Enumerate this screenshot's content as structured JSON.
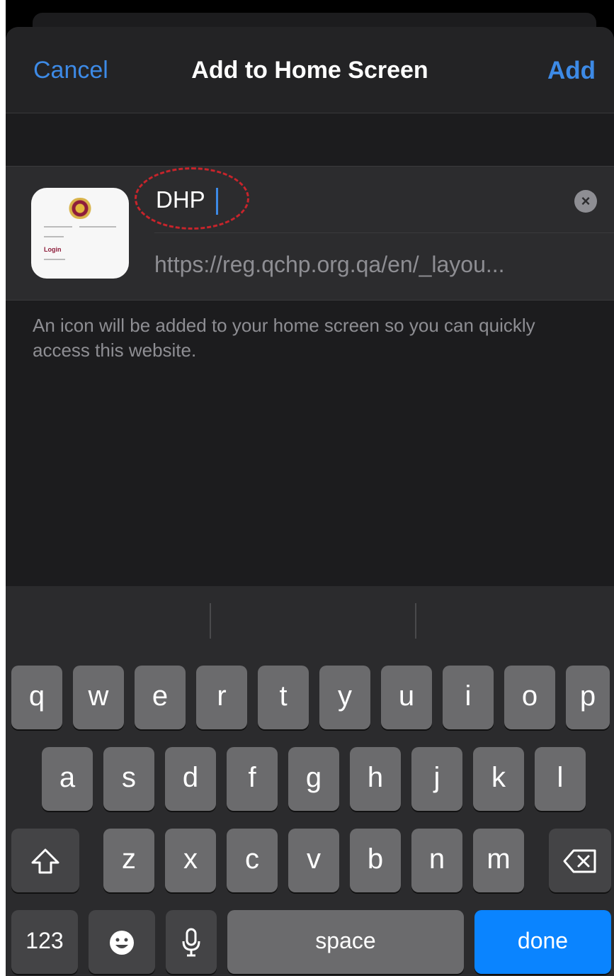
{
  "nav": {
    "cancel": "Cancel",
    "title": "Add to Home Screen",
    "add": "Add"
  },
  "form": {
    "name_value": "DHP",
    "url": "https://reg.qchp.org.qa/en/_layou...",
    "clear_icon": "clear-text-icon",
    "thumb_login": "Login"
  },
  "hint": "An icon will be added to your home screen so you can quickly access this website.",
  "keyboard": {
    "row1": [
      "q",
      "w",
      "e",
      "r",
      "t",
      "y",
      "u",
      "i",
      "o",
      "p"
    ],
    "row2": [
      "a",
      "s",
      "d",
      "f",
      "g",
      "h",
      "j",
      "k",
      "l"
    ],
    "row3": [
      "z",
      "x",
      "c",
      "v",
      "b",
      "n",
      "m"
    ],
    "numbers": "123",
    "space": "space",
    "done": "done",
    "icons": {
      "shift": "shift-icon",
      "delete": "delete-icon",
      "emoji": "emoji-icon",
      "mic": "microphone-icon"
    }
  },
  "colors": {
    "accent": "#3d8ae6",
    "done": "#0a84ff",
    "annotation": "#c8242b"
  }
}
